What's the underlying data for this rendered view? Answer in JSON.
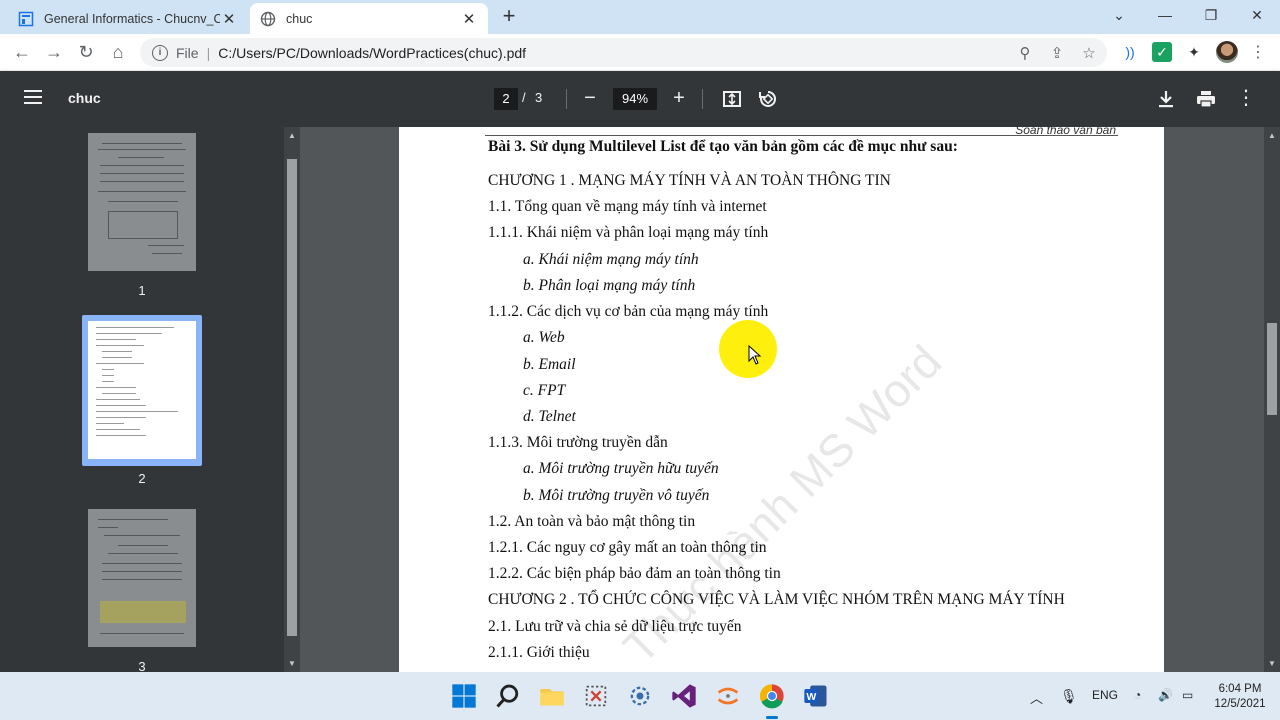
{
  "browser": {
    "tabs": [
      {
        "title": "General Informatics - Chucnv_Co",
        "active": false
      },
      {
        "title": "chuc",
        "active": true
      }
    ],
    "omnibox": {
      "scheme": "File",
      "url": "C:/Users/PC/Downloads/WordPractices(chuc).pdf"
    }
  },
  "pdf_toolbar": {
    "doc_name": "chuc",
    "current_page": "2",
    "page_separator": "/",
    "total_pages": "3",
    "zoom": "94%"
  },
  "sidebar": {
    "thumbnails": [
      {
        "number": "1",
        "selected": false
      },
      {
        "number": "2",
        "selected": true
      },
      {
        "number": "3",
        "selected": false
      }
    ]
  },
  "document": {
    "running_header": "Soạn thảo văn bản",
    "watermark": "Thực hành MS Word",
    "lines": [
      {
        "text": "Bài 3.  Sử dụng Multilevel List để tạo văn bản gồm các đề mục như sau:",
        "style": "bold"
      },
      {
        "text": "CHƯƠNG 1  . MẠNG MÁY TÍNH VÀ AN TOÀN THÔNG TIN",
        "style": "normal"
      },
      {
        "text": "1.1.   Tổng quan về mạng máy tính và internet",
        "style": "normal"
      },
      {
        "text": "1.1.1.  Khái niệm và phân loại mạng máy tính",
        "style": "normal"
      },
      {
        "text": "a.  Khái niệm mạng máy tính",
        "style": "italic-indent"
      },
      {
        "text": "b.  Phân loại mạng máy tính",
        "style": "italic-indent"
      },
      {
        "text": "1.1.2.  Các dịch vụ cơ bản của mạng máy tính",
        "style": "normal"
      },
      {
        "text": "a.  Web",
        "style": "italic-indent"
      },
      {
        "text": "b.  Email",
        "style": "italic-indent"
      },
      {
        "text": "c.  FPT",
        "style": "italic-indent"
      },
      {
        "text": "d.  Telnet",
        "style": "italic-indent"
      },
      {
        "text": "1.1.3.  Môi trường truyền dẫn",
        "style": "normal"
      },
      {
        "text": "a.  Môi trường truyền hữu tuyến",
        "style": "italic-indent"
      },
      {
        "text": "b.  Môi trường truyền vô tuyến",
        "style": "italic-indent"
      },
      {
        "text": "1.2.   An toàn và bảo mật thông tin",
        "style": "normal"
      },
      {
        "text": "1.2.1.  Các nguy cơ gây mất an toàn thông tin",
        "style": "normal"
      },
      {
        "text": "1.2.2.  Các biện pháp bảo đảm an toàn thông tin",
        "style": "normal"
      },
      {
        "text": "CHƯƠNG 2  . TỔ CHỨC CÔNG VIỆC VÀ LÀM VIỆC NHÓM TRÊN MẠNG MÁY TÍNH",
        "style": "normal"
      },
      {
        "text": "2.1.   Lưu trữ và chia sẻ dữ liệu trực tuyến",
        "style": "normal"
      },
      {
        "text": "2.1.1.  Giới thiệu",
        "style": "normal"
      }
    ]
  },
  "taskbar": {
    "language": "ENG",
    "time": "6:04 PM",
    "date": "12/5/2021"
  },
  "colors": {
    "tabstrip": "#cfe3f5",
    "pdf_toolbar": "#323639",
    "viewer_bg": "#525659",
    "thumb_selected": "#8ab4f8",
    "cursor_highlight": "#ffee00"
  }
}
